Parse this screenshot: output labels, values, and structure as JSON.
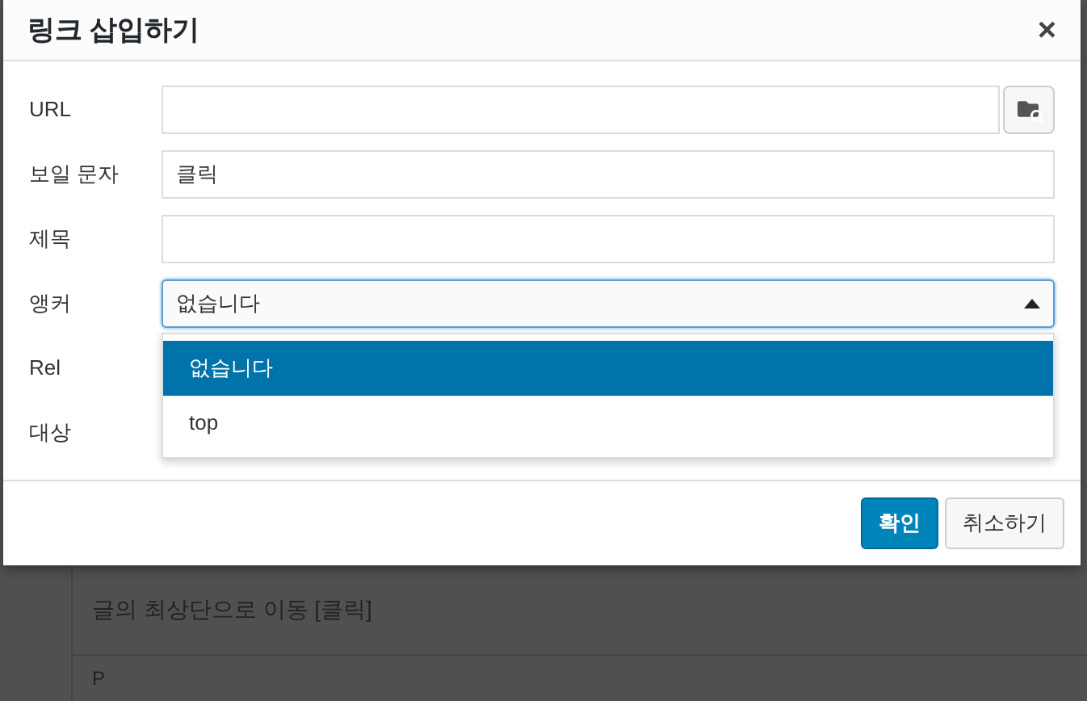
{
  "dialog": {
    "title": "링크 삽입하기",
    "close": "×",
    "fields": [
      {
        "kind": "url",
        "label": "URL"
      },
      {
        "kind": "text",
        "label": "보일 문자",
        "value": "클릭"
      },
      {
        "kind": "text",
        "label": "제목"
      },
      {
        "kind": "select",
        "label": "앵커",
        "value": "없습니다",
        "expanded": true,
        "options": [
          {
            "label": "없습니다",
            "selected": true
          },
          {
            "label": "top",
            "selected": false
          }
        ]
      },
      {
        "kind": "hidden",
        "label": "Rel"
      },
      {
        "kind": "hidden",
        "label": "대상"
      }
    ],
    "buttons": [
      {
        "label": "확인",
        "kind": "primary"
      },
      {
        "label": "취소하기",
        "kind": "secondary"
      }
    ]
  },
  "editor": {
    "text": "글의 최상단으로 이동 [클릭]",
    "status": "P"
  }
}
